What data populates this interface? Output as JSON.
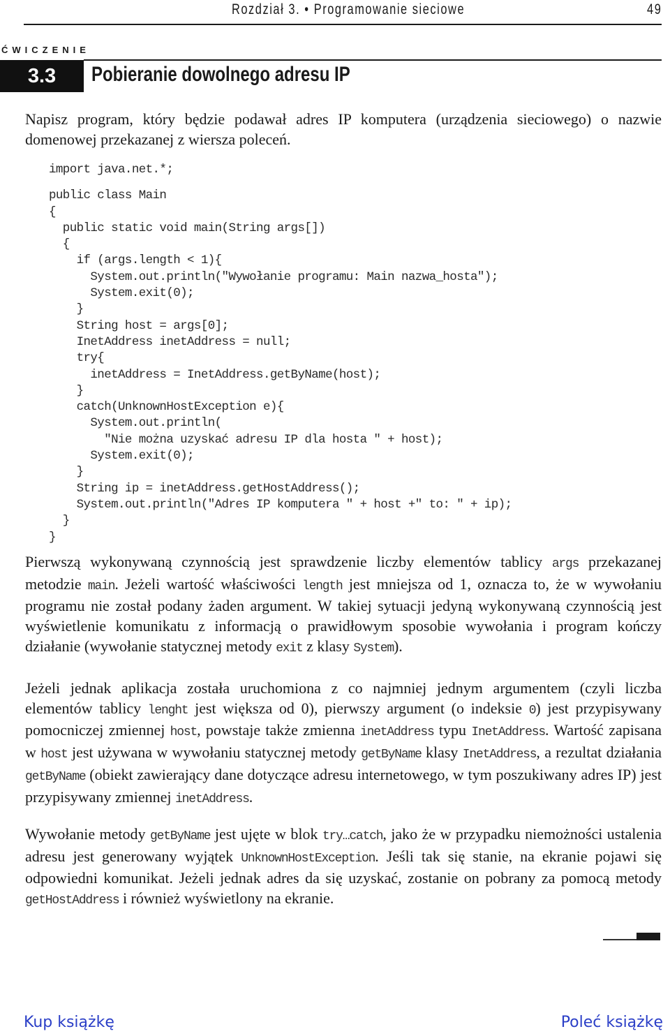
{
  "header": {
    "chapter": "Rozdział 3. • Programowanie sieciowe",
    "page_number": "49"
  },
  "exercise": {
    "label": "ĆWICZENIE",
    "number": "3.3",
    "title": "Pobieranie dowolnego adresu IP"
  },
  "intro": "Napisz program, który będzie podawał adres IP komputera (urządzenia sieciowego) o nazwie domenowej przekazanej z wiersza poleceń.",
  "code": [
    "import java.net.*;",
    "public class Main",
    "{",
    "  public static void main(String args[])",
    "  {",
    "    if (args.length < 1){",
    "      System.out.println(\"Wywołanie programu: Main nazwa_hosta\");",
    "      System.exit(0);",
    "    }",
    "    String host = args[0];",
    "    InetAddress inetAddress = null;",
    "    try{",
    "      inetAddress = InetAddress.getByName(host);",
    "    }",
    "    catch(UnknownHostException e){",
    "      System.out.println(",
    "        \"Nie można uzyskać adresu IP dla hosta \" + host);",
    "      System.exit(0);",
    "    }",
    "    String ip = inetAddress.getHostAddress();",
    "    System.out.println(\"Adres IP komputera \" + host +\" to: \" + ip);",
    "  }",
    "}"
  ],
  "paragraphs": [
    [
      {
        "t": "Pierwszą wykonywaną czynnością jest sprawdzenie liczby elementów tablicy "
      },
      {
        "c": "args"
      },
      {
        "t": " przekazanej metodzie "
      },
      {
        "c": "main"
      },
      {
        "t": ". Jeżeli wartość właściwości "
      },
      {
        "c": "length"
      },
      {
        "t": " jest mniejsza od 1, oznacza to, że w wywołaniu programu nie został podany żaden argument. W takiej sytuacji jedyną wykonywaną czynnością jest wyświetlenie komunikatu z informacją o prawidłowym sposobie wywołania i program kończy działanie (wywołanie statycznej metody "
      },
      {
        "c": "exit"
      },
      {
        "t": " z klasy "
      },
      {
        "c": "System"
      },
      {
        "t": ")."
      }
    ],
    [
      {
        "t": "Jeżeli jednak aplikacja została uruchomiona z co najmniej jednym argumentem (czyli liczba elementów tablicy "
      },
      {
        "c": "lenght"
      },
      {
        "t": " jest większa od 0), pierwszy argument (o indeksie "
      },
      {
        "c": "0"
      },
      {
        "t": ") jest przypisywany pomocniczej zmiennej "
      },
      {
        "c": "host"
      },
      {
        "t": ", powstaje także zmienna "
      },
      {
        "c": "inetAddress"
      },
      {
        "t": " typu "
      },
      {
        "c": "InetAddress"
      },
      {
        "t": ". Wartość zapisana w "
      },
      {
        "c": "host"
      },
      {
        "t": " jest używana w wywołaniu statycznej metody "
      },
      {
        "c": "getByName"
      },
      {
        "t": " klasy "
      },
      {
        "c": "InetAddress"
      },
      {
        "t": ", a rezultat działania "
      },
      {
        "c": "getByName"
      },
      {
        "t": " (obiekt zawierający dane dotyczące adresu internetowego, w tym poszukiwany adres IP) jest przypisywany zmiennej "
      },
      {
        "c": "inetAddress"
      },
      {
        "t": "."
      }
    ],
    [
      {
        "t": "Wywołanie metody "
      },
      {
        "c": "getByName"
      },
      {
        "t": " jest ujęte w blok "
      },
      {
        "c": "try…catch"
      },
      {
        "t": ", jako że w przypadku niemożności ustalenia adresu jest generowany wyjątek "
      },
      {
        "c": "UnknownHostException"
      },
      {
        "t": ". Jeśli tak się stanie, na ekranie pojawi się odpowiedni komunikat. Jeżeli jednak adres da się uzyskać, zostanie on pobrany za pomocą metody "
      },
      {
        "c": "getHostAddress"
      },
      {
        "t": " i również wyświetlony na ekranie."
      }
    ]
  ],
  "footer": {
    "buy_link": "Kup książkę",
    "recommend_link": "Poleć książkę",
    "link_color": "#2b3fc7"
  }
}
